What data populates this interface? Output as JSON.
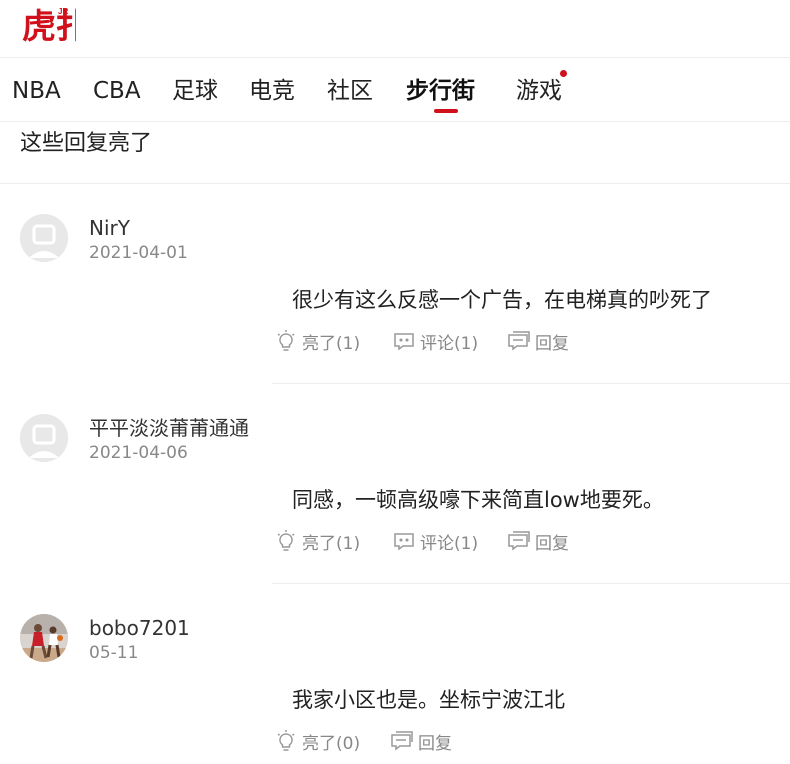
{
  "brand": {
    "logo_text": "虎扑",
    "accent_color": "#d0111b"
  },
  "nav": {
    "items": [
      {
        "label": "NBA"
      },
      {
        "label": "CBA"
      },
      {
        "label": "足球"
      },
      {
        "label": "电竞"
      },
      {
        "label": "社区"
      },
      {
        "label": "步行街",
        "active": true
      },
      {
        "label": "游戏",
        "has_notification_dot": true
      }
    ]
  },
  "section": {
    "title": "这些回复亮了"
  },
  "comments": [
    {
      "username": "NirY",
      "date": "2021-04-01",
      "avatar": "default-avatar-icon",
      "content": "很少有这么反感一个广告，在电梯真的吵死了",
      "light_label": "亮了(1)",
      "comment_label": "评论(1)",
      "reply_label": "回复"
    },
    {
      "username": "平平淡淡莆莆通通",
      "date": "2021-04-06",
      "avatar": "default-avatar-icon",
      "content": "同感，一顿高级嚎下来简直low地要死。",
      "light_label": "亮了(1)",
      "comment_label": "评论(1)",
      "reply_label": "回复"
    },
    {
      "username": "bobo7201",
      "date": "05-11",
      "avatar": "basketball-player-avatar",
      "content": "我家小区也是。坐标宁波江北",
      "light_label": "亮了(0)",
      "reply_label": "回复"
    }
  ]
}
